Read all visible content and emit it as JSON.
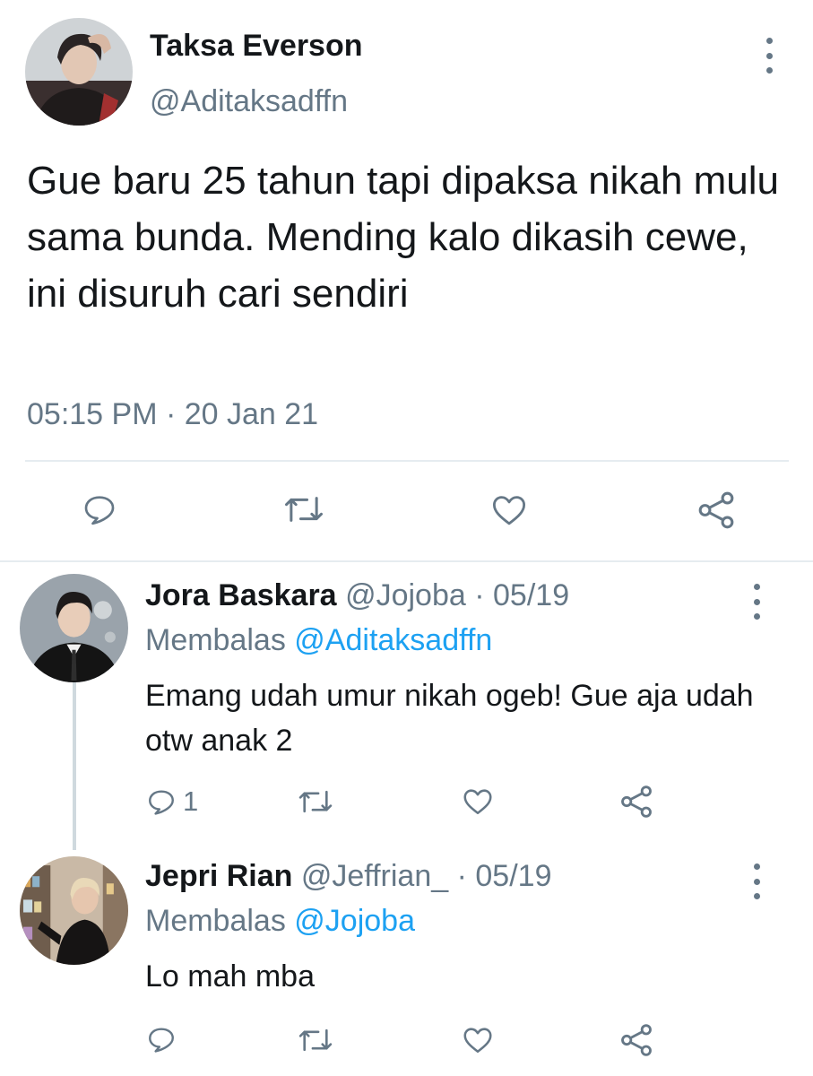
{
  "main_tweet": {
    "author_name": "Taksa Everson",
    "author_handle": "@Aditaksadffn",
    "text": "Gue baru 25 tahun tapi dipaksa nikah mulu sama bunda. Mending kalo dikasih cewe, ini disuruh cari sendiri",
    "timestamp": "05:15 PM · 20 Jan 21",
    "icons": [
      "reply-icon",
      "retweet-icon",
      "like-icon",
      "share-icon",
      "more-vertical-icon"
    ]
  },
  "replies": [
    {
      "author_name": "Jora Baskara",
      "author_handle": "@Jojoba",
      "separator": "·",
      "date": "05/19",
      "replying_label": "Membalas",
      "replying_to": "@Aditaksadffn",
      "text": "Emang udah umur nikah ogeb! Gue aja udah otw anak 2",
      "reply_count": "1"
    },
    {
      "author_name": "Jepri Rian",
      "author_handle": "@Jeffrian_",
      "separator": "·",
      "date": "05/19",
      "replying_label": "Membalas",
      "replying_to": "@Jojoba",
      "text": "Lo mah mba",
      "reply_count": ""
    }
  ],
  "colors": {
    "text": "#14171a",
    "secondary": "#657786",
    "accent": "#1da1f2",
    "divider": "#e6ecf0"
  }
}
